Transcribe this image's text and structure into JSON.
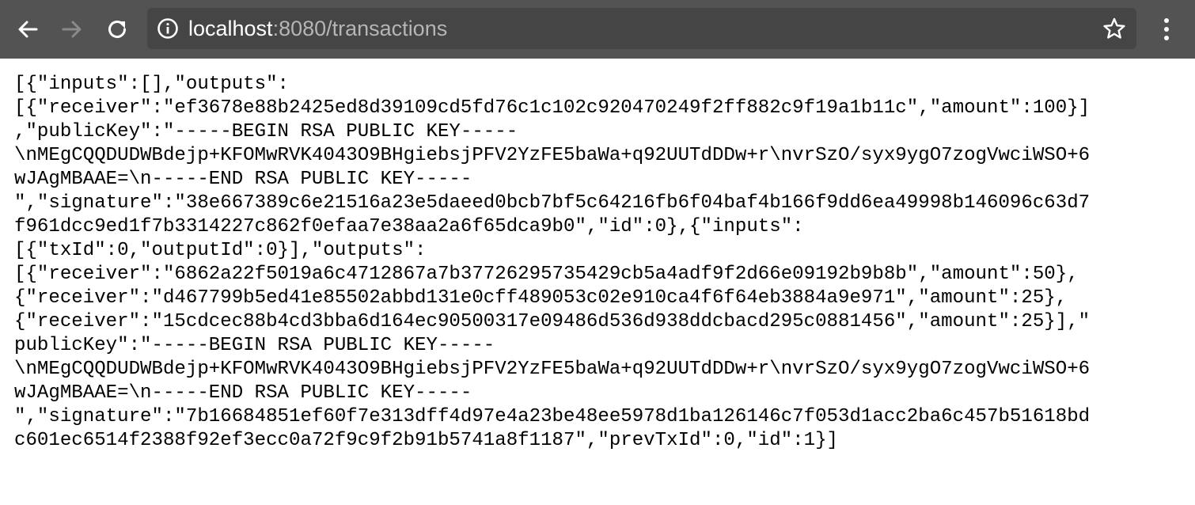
{
  "browser": {
    "url_host": "localhost",
    "url_rest": ":8080/transactions",
    "icons": {
      "back": "arrow-left-icon",
      "forward": "arrow-right-icon",
      "reload": "reload-icon",
      "info": "info-circle-icon",
      "bookmark": "star-outline-icon",
      "menu": "vertical-dots-menu-icon"
    },
    "colors": {
      "toolbar": "#535353",
      "omnibox": "#454545",
      "url_host": "#ffffff",
      "url_rest": "#b5b5b5"
    }
  },
  "page": {
    "lines": [
      "[{\"inputs\":[],\"outputs\":",
      "[{\"receiver\":\"ef3678e88b2425ed8d39109cd5fd76c1c102c920470249f2ff882c9f19a1b11c\",\"amount\":100}]",
      ",\"publicKey\":\"-----BEGIN RSA PUBLIC KEY-----",
      "\\nMEgCQQDUDWBdejp+KFOMwRVK4043O9BHgiebsjPFV2YzFE5baWa+q92UUTdDDw+r\\nvrSzO/syx9ygO7zogVwciWSO+6",
      "wJAgMBAAE=\\n-----END RSA PUBLIC KEY-----",
      "\",\"signature\":\"38e667389c6e21516a23e5daeed0bcb7bf5c64216fb6f04baf4b166f9dd6ea49998b146096c63d7",
      "f961dcc9ed1f7b3314227c862f0efaa7e38aa2a6f65dca9b0\",\"id\":0},{\"inputs\":",
      "[{\"txId\":0,\"outputId\":0}],\"outputs\":",
      "[{\"receiver\":\"6862a22f5019a6c4712867a7b37726295735429cb5a4adf9f2d66e09192b9b8b\",\"amount\":50},",
      "{\"receiver\":\"d467799b5ed41e85502abbd131e0cff489053c02e910ca4f6f64eb3884a9e971\",\"amount\":25},",
      "{\"receiver\":\"15cdcec88b4cd3bba6d164ec90500317e09486d536d938ddcbacd295c0881456\",\"amount\":25}],\"",
      "publicKey\":\"-----BEGIN RSA PUBLIC KEY-----",
      "\\nMEgCQQDUDWBdejp+KFOMwRVK4043O9BHgiebsjPFV2YzFE5baWa+q92UUTdDDw+r\\nvrSzO/syx9ygO7zogVwciWSO+6",
      "wJAgMBAAE=\\n-----END RSA PUBLIC KEY-----",
      "\",\"signature\":\"7b16684851ef60f7e313dff4d97e4a23be48ee5978d1ba126146c7f053d1acc2ba6c457b51618bd",
      "c601ec6514f2388f92ef3ecc0a72f9c9f2b91b5741a8f1187\",\"prevTxId\":0,\"id\":1}]"
    ]
  }
}
